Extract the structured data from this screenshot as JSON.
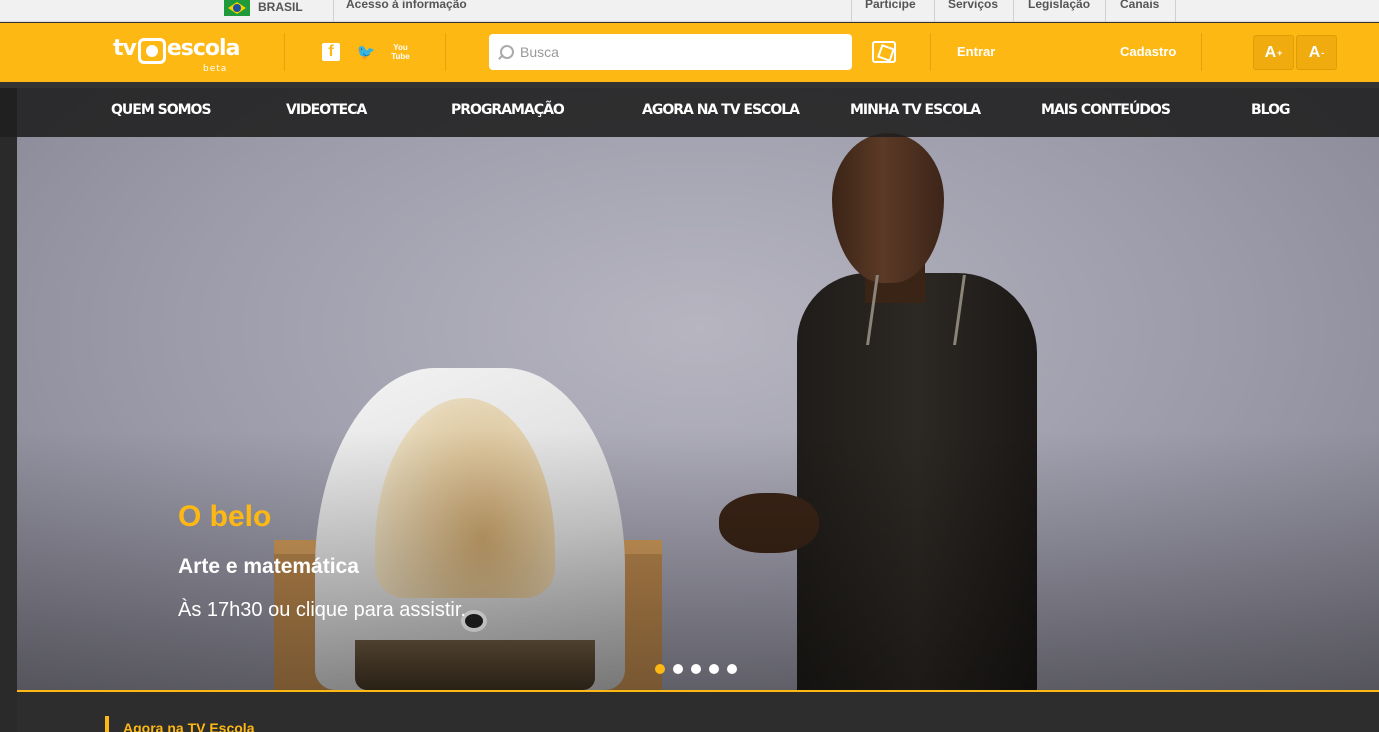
{
  "govbar": {
    "country": "BRASIL",
    "access_info": "Acesso à informação",
    "links": [
      "Participe",
      "Serviços",
      "Legislação",
      "Canais"
    ]
  },
  "header": {
    "logo_tv": "tv",
    "logo_escola": "escola",
    "logo_beta": "beta",
    "social": [
      {
        "icon": "facebook-icon",
        "glyph": "f"
      },
      {
        "icon": "twitter-icon",
        "glyph": "🐦"
      },
      {
        "icon": "youtube-icon",
        "glyph": "You Tube"
      }
    ],
    "search_placeholder": "Busca",
    "login": "Entrar",
    "register": "Cadastro",
    "font_increase": "A",
    "font_decrease": "A",
    "font_increase_sign": "+",
    "font_decrease_sign": "-"
  },
  "nav": {
    "items": [
      "QUEM SOMOS",
      "VIDEOTECA",
      "PROGRAMAÇÃO",
      "AGORA NA TV ESCOLA",
      "MINHA TV ESCOLA",
      "MAIS CONTEÚDOS",
      "BLOG"
    ]
  },
  "hero": {
    "title": "O belo",
    "subtitle": "Arte e matemática",
    "cta": "Às 17h30 ou clique para assistir.",
    "slides": 5,
    "active_slide": 1
  },
  "section": {
    "label": "Agora na TV Escola"
  },
  "colors": {
    "brand_yellow": "#fdb813",
    "nav_dark": "#1e1e1e"
  }
}
